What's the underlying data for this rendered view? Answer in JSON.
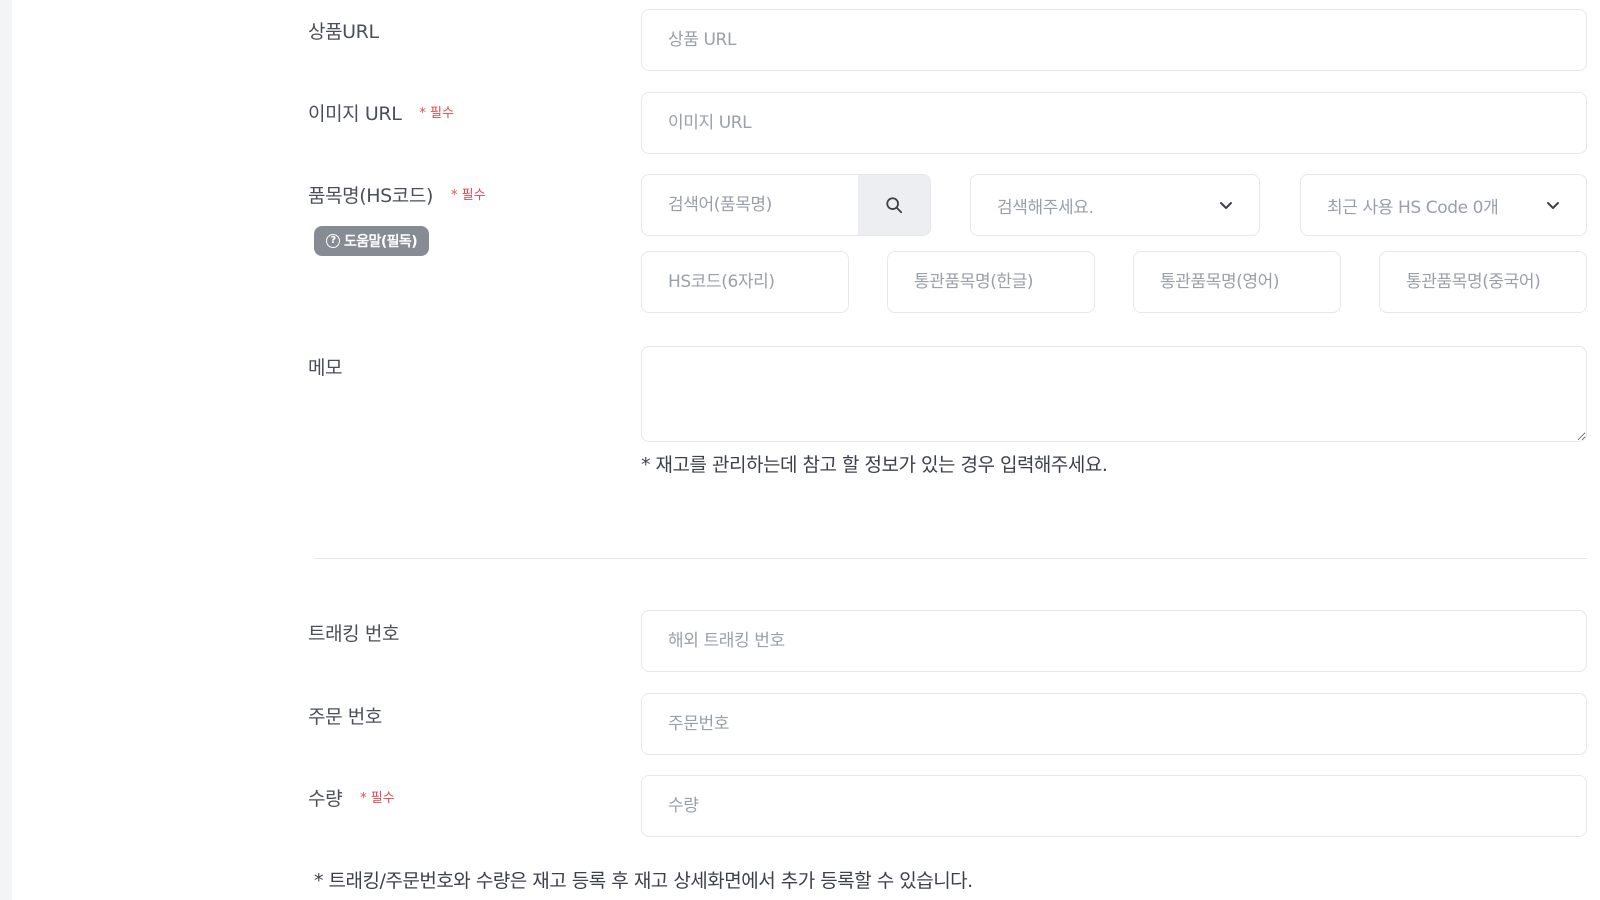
{
  "required_mark": "* 필수",
  "product_url": {
    "label": "상품URL",
    "placeholder": "상품 URL",
    "value": ""
  },
  "image_url": {
    "label": "이미지 URL",
    "placeholder": "이미지 URL",
    "value": ""
  },
  "item_name": {
    "label": "품목명(HS코드)",
    "help_button": "도움말(필독)",
    "help_icon": "question-circle-icon",
    "search_placeholder": "검색어(품목명)",
    "search_icon": "search-icon",
    "result_select": "검색해주세요.",
    "recent_select": "최근 사용 HS Code 0개",
    "hs_code_placeholder": "HS코드(6자리)",
    "name_kr_placeholder": "통관품목명(한글)",
    "name_en_placeholder": "통관품목명(영어)",
    "name_cn_placeholder": "통관품목명(중국어)"
  },
  "memo": {
    "label": "메모",
    "value": "",
    "note": "* 재고를 관리하는데 참고 할 정보가 있는 경우 입력해주세요."
  },
  "tracking": {
    "label": "트래킹 번호",
    "placeholder": "해외 트래킹 번호",
    "value": ""
  },
  "order": {
    "label": "주문 번호",
    "placeholder": "주문번호",
    "value": ""
  },
  "quantity": {
    "label": "수량",
    "placeholder": "수량",
    "value": ""
  },
  "footer_note": "* 트래킹/주문번호와 수량은 재고 등록 후 재고 상세화면에서 추가 등록할 수 있습니다.",
  "colors": {
    "required": "#e5484d",
    "badge": "#868b94",
    "border": "#e5e7eb"
  }
}
